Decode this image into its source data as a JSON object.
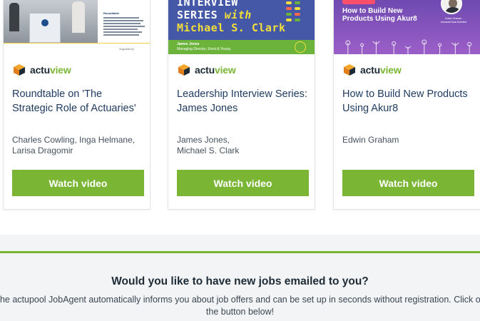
{
  "cards": [
    {
      "thumb": {
        "slide_title": "Roundtable",
        "supported_by": "Supported by"
      },
      "brand": {
        "prefix": "actu",
        "suffix": "view"
      },
      "title": "Roundtable on 'The Strategic Role of Actuaries'",
      "authors": "Charles Cowling, Inga Helmane, Larisa Dragomir",
      "button": "Watch video"
    },
    {
      "thumb": {
        "line1": "INTERVIEW",
        "line2a": "SERIES ",
        "line2b": "with",
        "line3": "Michael S. Clark",
        "name": "James Jones",
        "role": "Managing Director, Ernst & Young"
      },
      "brand": {
        "prefix": "actu",
        "suffix": "view"
      },
      "title": "Leadership Interview Series: James Jones",
      "authors": "James Jones, Michael S. Clark",
      "button": "Watch video"
    },
    {
      "thumb": {
        "headline": "How to Build New Products Using Akur8",
        "caption_name": "Edwin Graham",
        "caption_role": "Actuarial Data Scientist"
      },
      "brand": {
        "prefix": "actu",
        "suffix": "view"
      },
      "title": "How to Build New Products Using Akur8",
      "authors": "Edwin Graham",
      "button": "Watch video"
    }
  ],
  "jobagent": {
    "headline": "Would you like to have new jobs emailed to you?",
    "description": "The actupool JobAgent automatically informs you about job offers and can be set up in seconds without registration. Click on the button below!"
  },
  "colors": {
    "accent_green": "#7ab534",
    "text_dark": "#1d2b36",
    "title_blue": "#1e3a5f",
    "bg_grey": "#f3f4f5"
  },
  "icons": [
    "actuview-cube-icon",
    "avatar-edwin-graham"
  ]
}
